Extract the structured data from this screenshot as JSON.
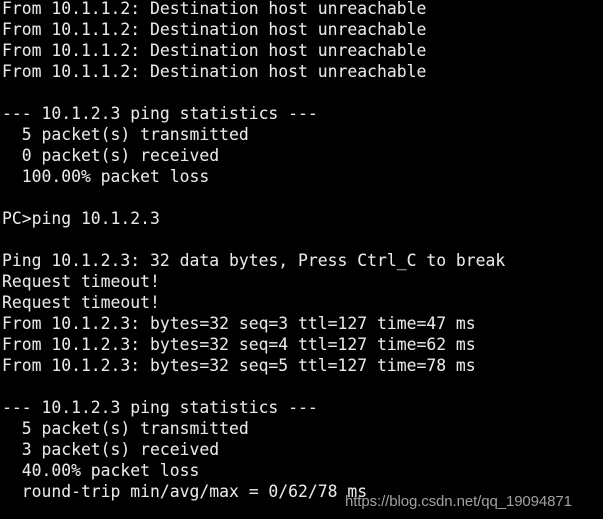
{
  "terminal": {
    "background_color": "#000000",
    "text_color": "#e8e8e8",
    "lines": [
      "From 10.1.1.2: Destination host unreachable",
      "From 10.1.1.2: Destination host unreachable",
      "From 10.1.1.2: Destination host unreachable",
      "From 10.1.1.2: Destination host unreachable",
      "",
      "--- 10.1.2.3 ping statistics ---",
      "  5 packet(s) transmitted",
      "  0 packet(s) received",
      "  100.00% packet loss",
      "",
      "PC>ping 10.1.2.3",
      "",
      "Ping 10.1.2.3: 32 data bytes, Press Ctrl_C to break",
      "Request timeout!",
      "Request timeout!",
      "From 10.1.2.3: bytes=32 seq=3 ttl=127 time=47 ms",
      "From 10.1.2.3: bytes=32 seq=4 ttl=127 time=62 ms",
      "From 10.1.2.3: bytes=32 seq=5 ttl=127 time=78 ms",
      "",
      "--- 10.1.2.3 ping statistics ---",
      "  5 packet(s) transmitted",
      "  3 packet(s) received",
      "  40.00% packet loss",
      "  round-trip min/avg/max = 0/62/78 ms"
    ],
    "prompt": "PC>",
    "command": "ping 10.1.2.3",
    "first_ping": {
      "target": "10.1.2.3",
      "unreachable_source": "10.1.1.2",
      "unreachable_message": "Destination host unreachable",
      "unreachable_count": 4,
      "transmitted": "5",
      "received": "0",
      "packet_loss": "100.00%"
    },
    "second_ping": {
      "target": "10.1.2.3",
      "data_bytes": "32",
      "break_hint": "Press Ctrl_C to break",
      "timeout_message": "Request timeout!",
      "timeout_count": 2,
      "replies": [
        {
          "source": "10.1.2.3",
          "bytes": "32",
          "seq": "3",
          "ttl": "127",
          "time": "47 ms"
        },
        {
          "source": "10.1.2.3",
          "bytes": "32",
          "seq": "4",
          "ttl": "127",
          "time": "62 ms"
        },
        {
          "source": "10.1.2.3",
          "bytes": "32",
          "seq": "5",
          "ttl": "127",
          "time": "78 ms"
        }
      ],
      "transmitted": "5",
      "received": "3",
      "packet_loss": "40.00%",
      "round_trip": "min/avg/max = 0/62/78 ms"
    }
  },
  "watermark": {
    "text": "https://blog.csdn.net/qq_19094871",
    "color": "#cdcdcd"
  }
}
